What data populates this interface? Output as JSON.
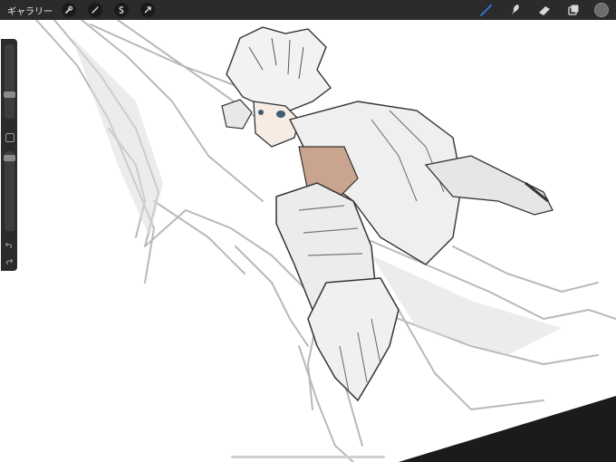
{
  "topbar": {
    "gallery_label": "ギャラリー",
    "left_tools": [
      {
        "name": "wrench-icon"
      },
      {
        "name": "magic-wand-icon"
      },
      {
        "name": "selection-icon"
      },
      {
        "name": "transform-arrow-icon"
      }
    ],
    "right_tools": [
      {
        "name": "brush-icon",
        "active": true
      },
      {
        "name": "smudge-icon"
      },
      {
        "name": "eraser-icon"
      },
      {
        "name": "layers-icon"
      }
    ],
    "current_color": "#6c6c6c",
    "accent_color": "#2f7fe0"
  },
  "sidebar": {
    "brush_size_level": 0.3,
    "opacity_level": 0.95,
    "icons": [
      "modify-square-icon",
      "undo-icon",
      "redo-icon"
    ]
  },
  "canvas": {
    "background": "#ffffff",
    "corner_fill": "#1b1b1b"
  }
}
